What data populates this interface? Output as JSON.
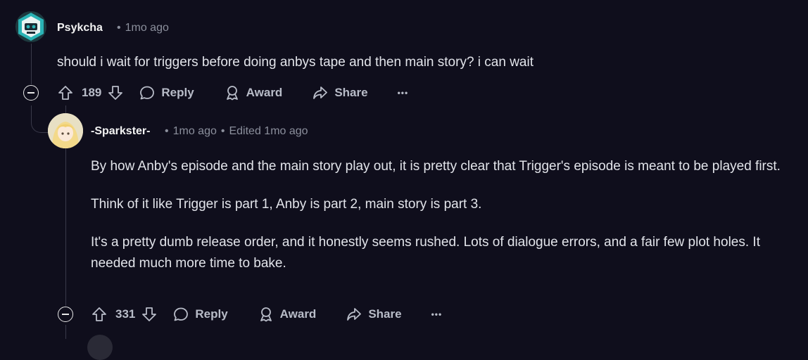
{
  "comment1": {
    "author": "Psykcha",
    "time": "1mo ago",
    "body": "should i wait for triggers before doing anbys tape and then main story? i can wait",
    "votes": "189",
    "reply_label": "Reply",
    "award_label": "Award",
    "share_label": "Share",
    "more_label": "•••"
  },
  "comment2": {
    "author": "-Sparkster-",
    "time": "1mo ago",
    "edited": "Edited 1mo ago",
    "paragraphs": [
      "By how Anby's episode and the main story play out, it is pretty clear that Trigger's episode is meant to be played first.",
      "Think of it like Trigger is part 1, Anby is part 2, main story is part 3.",
      "It's a pretty dumb release order, and it honestly seems rushed. Lots of dialogue errors, and a fair few plot holes. It needed much more time to bake."
    ],
    "votes": "331",
    "reply_label": "Reply",
    "award_label": "Award",
    "share_label": "Share",
    "more_label": "•••"
  },
  "meta_separator": "•"
}
